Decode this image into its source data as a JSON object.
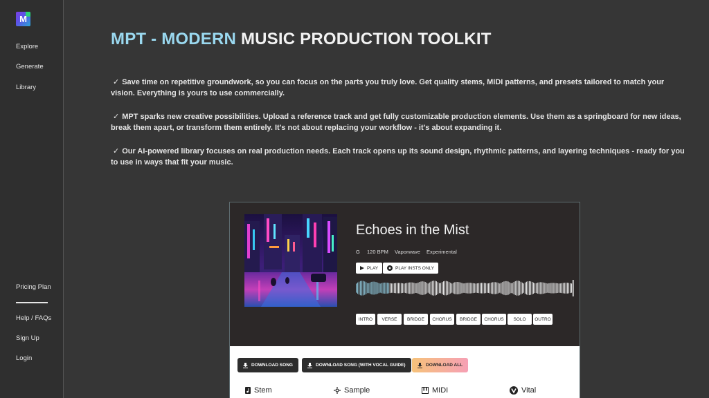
{
  "sidebar": {
    "logo_letter": "M",
    "top_items": [
      "Explore",
      "Generate",
      "Library"
    ],
    "bottom_items": [
      "Pricing Plan",
      "Help / FAQs",
      "Sign Up",
      "Login"
    ]
  },
  "header": {
    "title_accent": "MPT - MODERN",
    "title_rest": "MUSIC PRODUCTION TOOLKIT"
  },
  "paragraphs": [
    "Save time on repetitive groundwork, so you can focus on the parts you truly love. Get quality stems, MIDI patterns, and presets tailored to match your vision. Everything is yours to use commercially.",
    "MPT sparks new creative possibilities. Upload a reference track and get fully customizable production elements. Use them as a springboard for new ideas, break them apart, or transform them entirely. It's not about replacing your workflow - it's about expanding it.",
    "Our AI-powered library focuses on real production needs. Each track opens up its sound design, rhythmic patterns, and layering techniques - ready for you to use in ways that fit your music."
  ],
  "check_mark": "✓",
  "track": {
    "title": "Echoes in the Mist",
    "key": "G",
    "bpm": "120 BPM",
    "genre": "Vaporwave",
    "style": "Experimental",
    "play_label": "PLAY",
    "play_insts_label": "PLAY INSTS ONLY",
    "progress": 0.15,
    "sections": [
      "INTRO",
      "VERSE",
      "BRIDGE",
      "CHORUS",
      "BRIDGE",
      "CHORUS",
      "SOLO",
      "OUTRO"
    ]
  },
  "downloads": {
    "song": "DOWNLOAD SONG",
    "song_vocal": "DOWNLOAD SONG (WITH VOCAL GUIDE)",
    "all": "DOWNLOAD ALL"
  },
  "tabs": [
    "Stem",
    "Sample",
    "MIDI",
    "Vital"
  ],
  "colors": {
    "accent": "#9ad8ef",
    "waveform_played": "#8fc9dc",
    "waveform_rest": "#e8e8e8"
  }
}
